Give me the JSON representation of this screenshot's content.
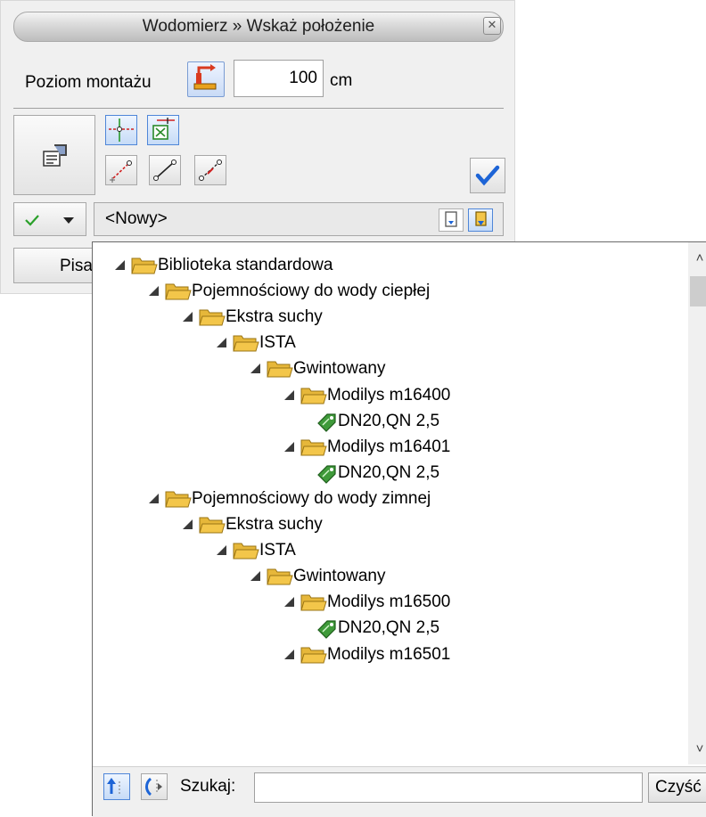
{
  "window": {
    "title": "Wodomierz » Wskaż położenie"
  },
  "panel": {
    "level_label": "Poziom montażu",
    "level_value": "100",
    "level_unit": "cm",
    "combo_value": "<Nowy>",
    "pisa_label": "Pisa"
  },
  "tree": {
    "items": [
      {
        "label": "Biblioteka standardowa",
        "depth": 0,
        "kind": "folder"
      },
      {
        "label": "Pojemnościowy do wody ciepłej",
        "depth": 1,
        "kind": "folder"
      },
      {
        "label": "Ekstra suchy",
        "depth": 2,
        "kind": "folder"
      },
      {
        "label": "ISTA",
        "depth": 3,
        "kind": "folder"
      },
      {
        "label": "Gwintowany",
        "depth": 4,
        "kind": "folder"
      },
      {
        "label": "Modilys m16400",
        "depth": 5,
        "kind": "folder"
      },
      {
        "label": "DN20,QN 2,5",
        "depth": 6,
        "kind": "item"
      },
      {
        "label": "Modilys m16401",
        "depth": 5,
        "kind": "folder"
      },
      {
        "label": "DN20,QN 2,5",
        "depth": 6,
        "kind": "item"
      },
      {
        "label": "Pojemnościowy do wody zimnej",
        "depth": 1,
        "kind": "folder"
      },
      {
        "label": "Ekstra suchy",
        "depth": 2,
        "kind": "folder"
      },
      {
        "label": "ISTA",
        "depth": 3,
        "kind": "folder"
      },
      {
        "label": "Gwintowany",
        "depth": 4,
        "kind": "folder"
      },
      {
        "label": "Modilys m16500",
        "depth": 5,
        "kind": "folder"
      },
      {
        "label": "DN20,QN 2,5",
        "depth": 6,
        "kind": "item"
      },
      {
        "label": "Modilys m16501",
        "depth": 5,
        "kind": "folder"
      }
    ]
  },
  "search": {
    "label": "Szukaj:",
    "value": "",
    "clear_label": "Czyść"
  },
  "colors": {
    "folder": "#f3c64a",
    "tag": "#3f9a3a",
    "accent": "#1d64d6"
  }
}
